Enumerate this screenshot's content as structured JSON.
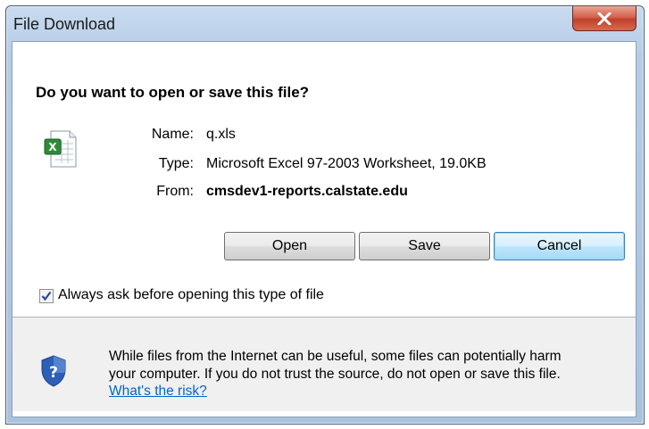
{
  "window": {
    "title": "File Download"
  },
  "dialog": {
    "question": "Do you want to open or save this file?",
    "file": {
      "icon": "excel-file-icon",
      "name_label": "Name:",
      "name_value": "q.xls",
      "type_label": "Type:",
      "type_value": "Microsoft Excel 97-2003 Worksheet, 19.0KB",
      "from_label": "From:",
      "from_value": "cmsdev1-reports.calstate.edu"
    },
    "buttons": {
      "open": "Open",
      "save": "Save",
      "cancel": "Cancel"
    },
    "checkbox": {
      "label": "Always ask before opening this type of file",
      "checked": true
    },
    "footer": {
      "icon": "security-shield-icon",
      "warning_line1": "While files from the Internet can be useful, some files can potentially harm",
      "warning_line2": "your computer. If you do not trust the source, do not open or save this file.",
      "risk_link": "What's the risk?"
    }
  },
  "colors": {
    "close_button": "#c0402b",
    "link": "#0066cc",
    "default_button_border": "#3c7fb1"
  }
}
